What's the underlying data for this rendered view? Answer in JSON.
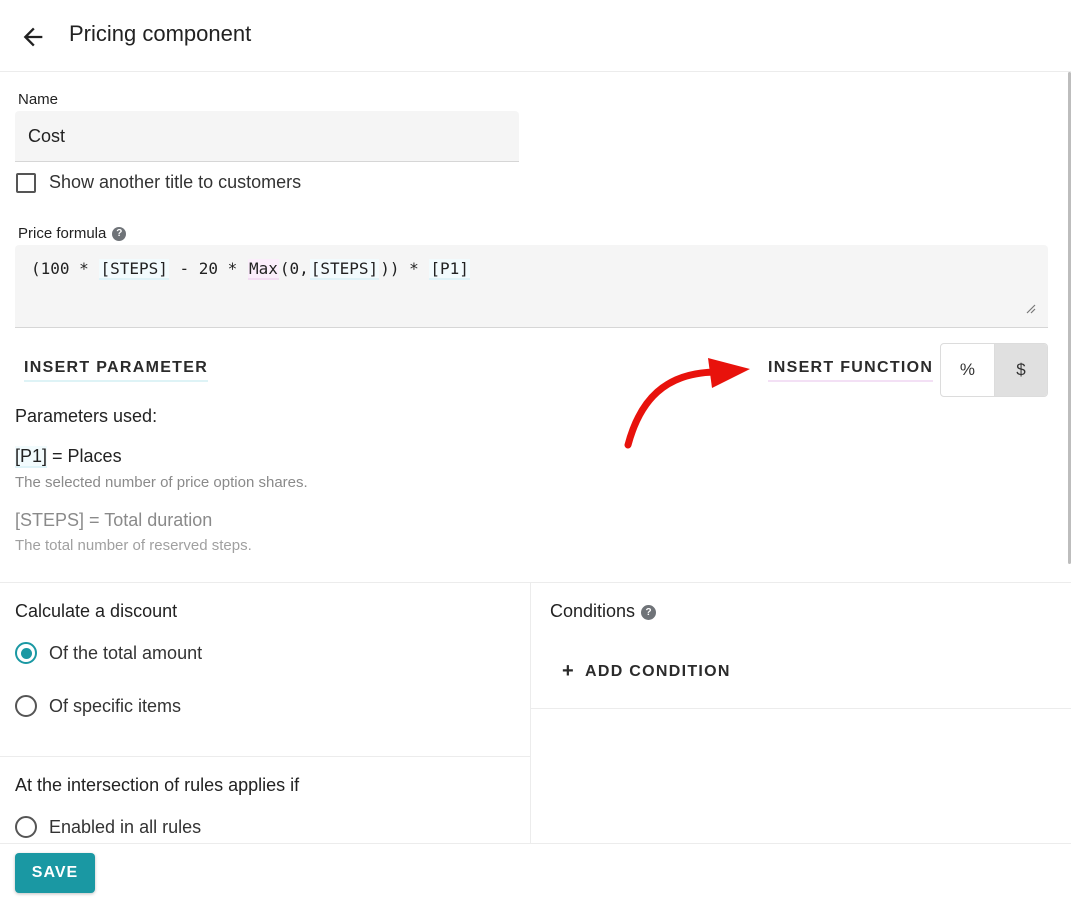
{
  "header": {
    "title": "Pricing component"
  },
  "name_field": {
    "label": "Name",
    "value": "Cost"
  },
  "alt_title_checkbox": {
    "label": "Show another title to customers",
    "checked": false
  },
  "price_formula": {
    "label": "Price formula",
    "tokens": [
      "(100 * ",
      "[STEPS]",
      " - 20 * ",
      "Max",
      "(0,",
      "[STEPS]",
      ")) * ",
      "[P1]"
    ]
  },
  "actions": {
    "insert_parameter": "INSERT PARAMETER",
    "insert_function": "INSERT FUNCTION"
  },
  "unit_toggle": {
    "options": [
      "%",
      "$"
    ],
    "selected": "$"
  },
  "parameters": {
    "title": "Parameters used:",
    "items": [
      {
        "code": "[P1]",
        "name": " = Places",
        "description": "The selected number of price option shares."
      },
      {
        "code": "[STEPS]",
        "name": " = Total duration",
        "description": "The total number of reserved steps."
      }
    ]
  },
  "discount": {
    "title": "Calculate a discount",
    "options": [
      "Of the total amount",
      "Of specific items"
    ],
    "selected": "Of the total amount"
  },
  "conditions": {
    "title": "Conditions",
    "add_label": "ADD CONDITION"
  },
  "intersection": {
    "title": "At the intersection of rules applies if",
    "options": [
      "Enabled in all rules"
    ]
  },
  "footer": {
    "save_label": "SAVE"
  },
  "colors": {
    "accent": "#1a98a3",
    "annotation_arrow": "#e8120c"
  }
}
